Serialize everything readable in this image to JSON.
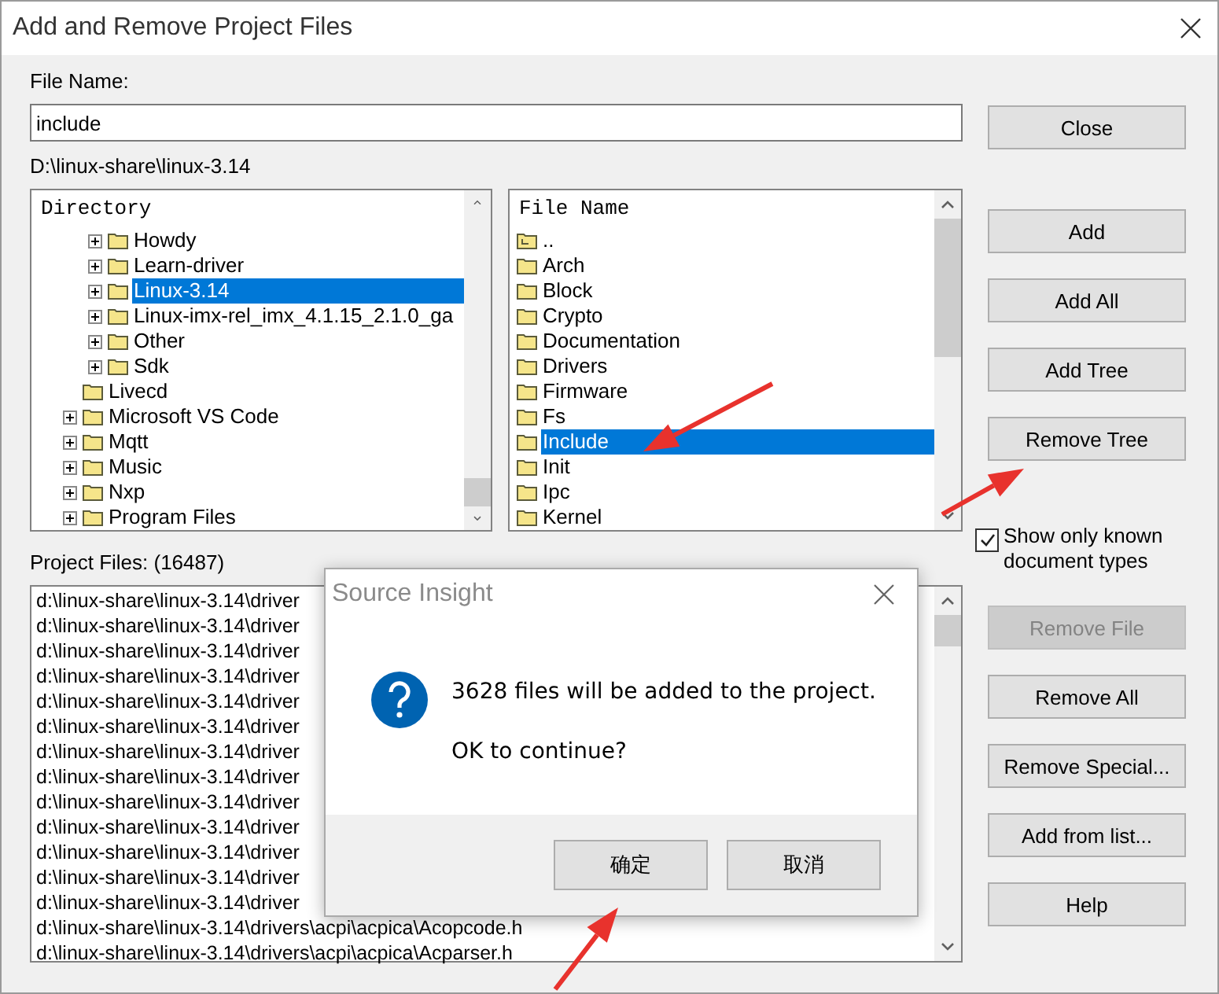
{
  "window": {
    "title": "Add and Remove Project Files"
  },
  "file_name": {
    "label": "File Name:",
    "value": "include"
  },
  "current_path": "D:\\linux-share\\linux-3.14",
  "directory": {
    "header": "Directory",
    "items": [
      {
        "children": [
          {
            "label": "Howdy",
            "expandable": true,
            "selected": false
          },
          {
            "label": "Learn-driver",
            "expandable": true,
            "selected": false
          },
          {
            "label": "Linux-3.14",
            "expandable": true,
            "selected": true
          },
          {
            "label": "Linux-imx-rel_imx_4.1.15_2.1.0_ga",
            "expandable": true,
            "selected": false
          },
          {
            "label": "Other",
            "expandable": true,
            "selected": false
          },
          {
            "label": "Sdk",
            "expandable": true,
            "selected": false
          }
        ]
      },
      {
        "label": "Livecd",
        "expandable": false,
        "selected": false
      },
      {
        "label": "Microsoft VS Code",
        "expandable": true,
        "selected": false
      },
      {
        "label": "Mqtt",
        "expandable": true,
        "selected": false
      },
      {
        "label": "Music",
        "expandable": true,
        "selected": false
      },
      {
        "label": "Nxp",
        "expandable": true,
        "selected": false
      },
      {
        "label": "Program Files",
        "expandable": true,
        "selected": false
      }
    ]
  },
  "files": {
    "header": "File Name",
    "items": [
      {
        "label": "..",
        "kind": "parent",
        "selected": false
      },
      {
        "label": "Arch",
        "kind": "folder",
        "selected": false
      },
      {
        "label": "Block",
        "kind": "folder",
        "selected": false
      },
      {
        "label": "Crypto",
        "kind": "folder",
        "selected": false
      },
      {
        "label": "Documentation",
        "kind": "folder",
        "selected": false
      },
      {
        "label": "Drivers",
        "kind": "folder",
        "selected": false
      },
      {
        "label": "Firmware",
        "kind": "folder",
        "selected": false
      },
      {
        "label": "Fs",
        "kind": "folder",
        "selected": false
      },
      {
        "label": "Include",
        "kind": "folder",
        "selected": true
      },
      {
        "label": "Init",
        "kind": "folder",
        "selected": false
      },
      {
        "label": "Ipc",
        "kind": "folder",
        "selected": false
      },
      {
        "label": "Kernel",
        "kind": "folder",
        "selected": false
      }
    ]
  },
  "project_files": {
    "label": "Project Files: (16487)",
    "rows": [
      "d:\\linux-share\\linux-3.14\\driver",
      "d:\\linux-share\\linux-3.14\\driver",
      "d:\\linux-share\\linux-3.14\\driver",
      "d:\\linux-share\\linux-3.14\\driver",
      "d:\\linux-share\\linux-3.14\\driver",
      "d:\\linux-share\\linux-3.14\\driver",
      "d:\\linux-share\\linux-3.14\\driver",
      "d:\\linux-share\\linux-3.14\\driver",
      "d:\\linux-share\\linux-3.14\\driver",
      "d:\\linux-share\\linux-3.14\\driver",
      "d:\\linux-share\\linux-3.14\\driver",
      "d:\\linux-share\\linux-3.14\\driver",
      "d:\\linux-share\\linux-3.14\\driver",
      "d:\\linux-share\\linux-3.14\\drivers\\acpi\\acpica\\Acopcode.h",
      "d:\\linux-share\\linux-3.14\\drivers\\acpi\\acpica\\Acparser.h"
    ]
  },
  "buttons_top": [
    {
      "label": "Close",
      "disabled": false
    }
  ],
  "buttons_add": [
    {
      "label": "Add",
      "disabled": false
    },
    {
      "label": "Add All",
      "disabled": false
    },
    {
      "label": "Add Tree",
      "disabled": false
    },
    {
      "label": "Remove Tree",
      "disabled": false
    }
  ],
  "show_known_types": {
    "label": "Show only known document types",
    "checked": true
  },
  "buttons_remove": [
    {
      "label": "Remove File",
      "disabled": true
    },
    {
      "label": "Remove All",
      "disabled": false
    },
    {
      "label": "Remove Special...",
      "disabled": false
    },
    {
      "label": "Add from list...",
      "disabled": false
    },
    {
      "label": "Help",
      "disabled": false
    }
  ],
  "dialog": {
    "title": "Source Insight",
    "message": [
      "3628 files will be added to the project.",
      "OK to continue?"
    ],
    "buttons": [
      "确定",
      "取消"
    ]
  }
}
